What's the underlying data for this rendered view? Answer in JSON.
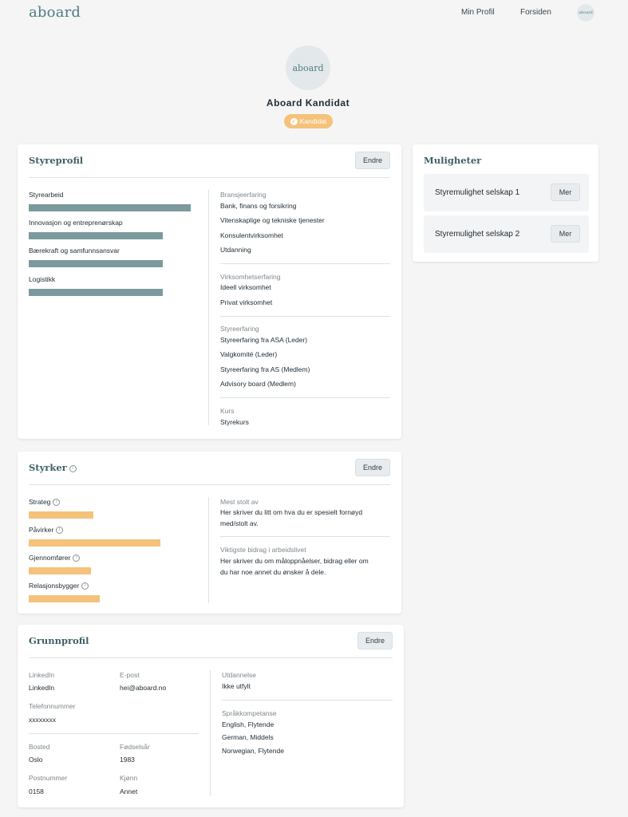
{
  "header": {
    "logo": "aboard",
    "nav": [
      "Min Profil",
      "Forsiden"
    ],
    "avatar_text": "aboard"
  },
  "profile": {
    "avatar_text": "aboard",
    "name": "Aboard Kandidat",
    "badge": "Kandidat"
  },
  "styreprofil": {
    "title": "Styreprofil",
    "edit": "Endre",
    "competencies": [
      {
        "label": "Styrearbeid",
        "level": 1.0
      },
      {
        "label": "Innovasjon og entreprenørskap",
        "level": 0.83
      },
      {
        "label": "Bærekraft og samfunnsansvar",
        "level": 0.83
      },
      {
        "label": "Logistikk",
        "level": 0.83
      }
    ],
    "bransje": {
      "label": "Bransjeerfaring",
      "items": [
        "Bank, finans og forsikring",
        "Vitenskaplige og tekniske tjenester",
        "Konsulentvirksomhet",
        "Utdanning"
      ]
    },
    "virksomhet": {
      "label": "Virksomhetserfaring",
      "items": [
        "Ideell virksomhet",
        "Privat virksomhet"
      ]
    },
    "styre": {
      "label": "Styreerfaring",
      "items": [
        "Styreerfaring fra ASA (Leder)",
        "Valgkomité (Leder)",
        "Styreerfaring fra AS (Medlem)",
        "Advisory board (Medlem)"
      ]
    },
    "kurs": {
      "label": "Kurs",
      "items": [
        "Styrekurs"
      ]
    }
  },
  "styrker": {
    "title": "Styrker",
    "edit": "Endre",
    "roles": [
      {
        "label": "Strateg",
        "level": 0.49
      },
      {
        "label": "Påvirker",
        "level": 1.0
      },
      {
        "label": "Gjennomfører",
        "level": 0.47
      },
      {
        "label": "Relasjonsbygger",
        "level": 0.54
      }
    ],
    "proud": {
      "label": "Mest stolt av",
      "text": [
        "Her skriver du litt om hva du er spesielt fornøyd",
        "med/stolt av."
      ]
    },
    "contrib": {
      "label": "Viktigste bidrag i arbeidslivet",
      "text": [
        "Her skriver du om måloppnåelser, bidrag eller om",
        "du har noe annet du ønsker å dele."
      ]
    }
  },
  "grunnprofil": {
    "title": "Grunnprofil",
    "edit": "Endre",
    "linkedin": {
      "label": "LinkedIn",
      "value": "LinkedIn"
    },
    "epost": {
      "label": "E-post",
      "value": "hei@aboard.no"
    },
    "telefon": {
      "label": "Telefonnummer",
      "value": "xxxxxxxx"
    },
    "bosted": {
      "label": "Bosted",
      "value": "Oslo"
    },
    "fodselsar": {
      "label": "Fødselsår",
      "value": "1983"
    },
    "postnummer": {
      "label": "Postnummer",
      "value": "0158"
    },
    "kjonn": {
      "label": "Kjønn",
      "value": "Annet"
    },
    "utdannelse": {
      "label": "Utdannelse",
      "value": "Ikke utfylt"
    },
    "sprak": {
      "label": "Språkkompetanse",
      "items": [
        "English, Flytende",
        "German, Middels",
        "Norwegian, Flytende"
      ]
    }
  },
  "muligheter": {
    "title": "Muligheter",
    "items": [
      {
        "name": "Styremulighet selskap 1",
        "button": "Mer"
      },
      {
        "name": "Styremulighet selskap 2",
        "button": "Mer"
      }
    ]
  },
  "colors": {
    "accent": "#4e7d84",
    "bar_teal": "#7c9a9e",
    "bar_orange": "#f4c27a",
    "background": "#f5f5f5"
  }
}
